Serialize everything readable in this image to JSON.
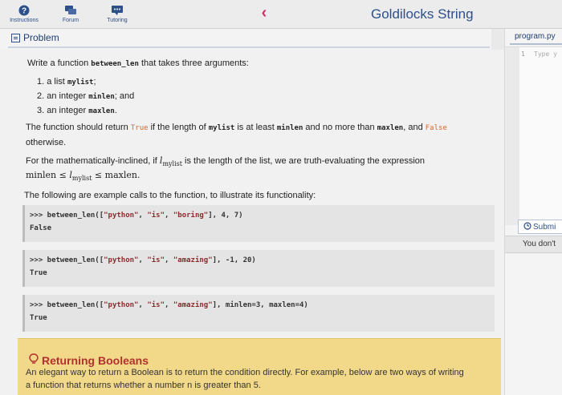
{
  "nav": {
    "instructions": "Instructions",
    "forum": "Forum",
    "tutoring": "Tutoring"
  },
  "app_title": "Goldilocks String",
  "problem_tab": "Problem",
  "intro": {
    "pre": "Write a function ",
    "fn": "between_len",
    "post": " that takes three arguments:"
  },
  "args": [
    {
      "num": "1.",
      "pre": "a list ",
      "code": "mylist",
      "post": ";"
    },
    {
      "num": "2.",
      "pre": "an integer ",
      "code": "minlen",
      "post": "; and"
    },
    {
      "num": "3.",
      "pre": "an integer ",
      "code": "maxlen",
      "post": "."
    }
  ],
  "return_line": {
    "p1": "The function should return ",
    "true_kw": "True",
    "p2": " if the length of ",
    "c1": "mylist",
    "p3": " is at least ",
    "c2": "minlen",
    "p4": " and no more than ",
    "c3": "maxlen",
    "p5": ", and ",
    "false_kw": "False",
    "p6": "otherwise."
  },
  "math_line": {
    "p1": "For the mathematically-inclined, if ",
    "l": "l",
    "sub": "mylist",
    "p2": " is the length of the list, we are truth-evaluating the expression",
    "expr_a": "minlen ≤ ",
    "expr_b": " ≤ maxlen."
  },
  "examples_intro": "The following are example calls to the function, to illustrate its functionality:",
  "examples": [
    {
      "call_pre": ">>> between_len([",
      "s1": "\"python\"",
      "s2": "\"is\"",
      "s3": "\"boring\"",
      "call_post": "], 4, 7)",
      "result": "False"
    },
    {
      "call_pre": ">>> between_len([",
      "s1": "\"python\"",
      "s2": "\"is\"",
      "s3": "\"amazing\"",
      "call_post": "], -1, 20)",
      "result": "True"
    },
    {
      "call_pre": ">>> between_len([",
      "s1": "\"python\"",
      "s2": "\"is\"",
      "s3": "\"amazing\"",
      "call_post": "], minlen=3, maxlen=4)",
      "result": "True"
    }
  ],
  "right_panel": {
    "file": "program.py",
    "line_no": "1",
    "type_hint": "Type y",
    "submit": "Submi",
    "notice": "You don't"
  },
  "hint": {
    "title": "Returning Booleans",
    "body1": "An elegant way to return a Boolean is to return the condition directly. For example, below are two ways of writing",
    "body2": "a function that returns whether a number n is greater than 5."
  }
}
